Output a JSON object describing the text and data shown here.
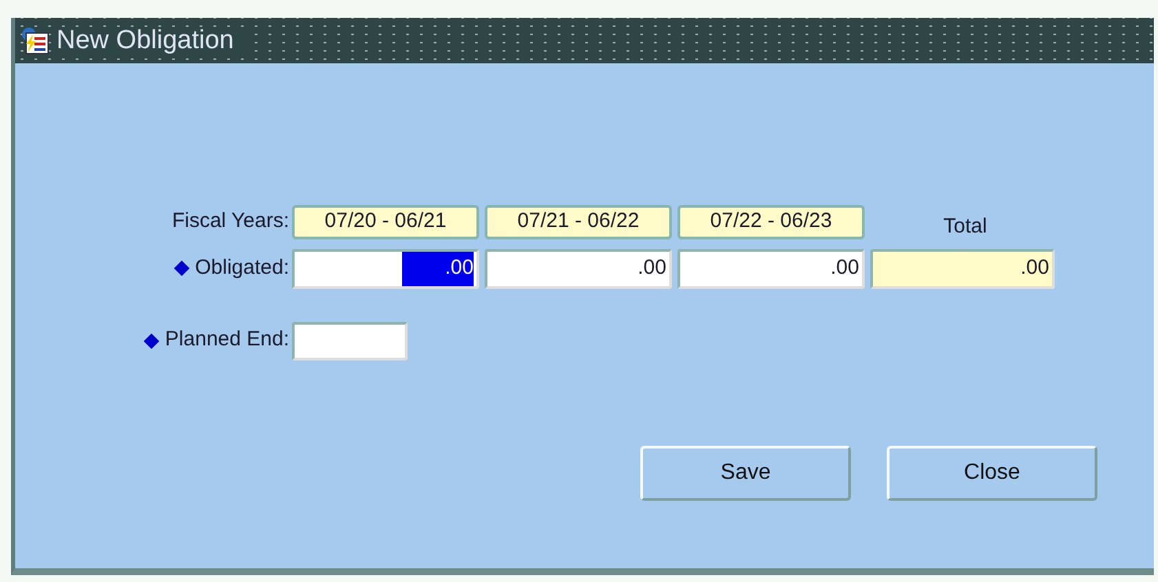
{
  "window": {
    "title": "New Obligation"
  },
  "fiscal_years": {
    "label": "Fiscal Years:",
    "years": [
      "07/20 - 06/21",
      "07/21 - 06/22",
      "07/22 - 06/23"
    ],
    "total_label": "Total"
  },
  "obligated": {
    "label": "Obligated:",
    "required": true,
    "values": [
      {
        "value": ".00",
        "selected": true
      },
      {
        "value": ".00",
        "selected": false
      },
      {
        "value": ".00",
        "selected": false
      }
    ],
    "total": ".00"
  },
  "planned_end": {
    "label": "Planned End:",
    "required": true
  },
  "buttons": [
    "Save",
    "Close"
  ]
}
